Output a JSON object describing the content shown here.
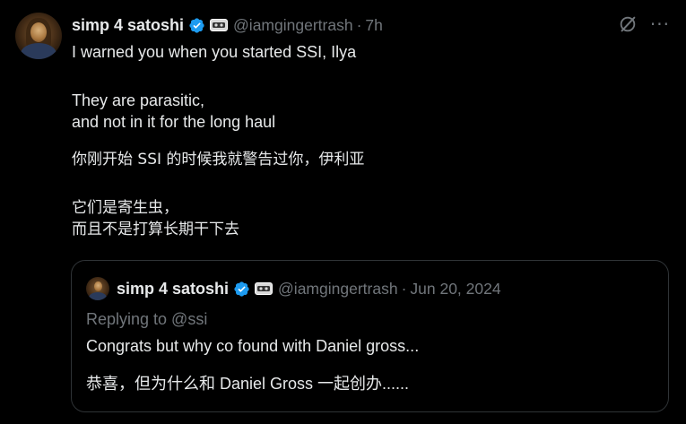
{
  "tweet": {
    "author": {
      "display_name": "simp 4 satoshi",
      "handle": "@iamgingertrash",
      "verified": true,
      "avatar_icon": "avatar-painting"
    },
    "separator": "·",
    "time": "7h",
    "lines": [
      "I warned you when you started SSI, Ilya",
      "They are parasitic,",
      "and not in it for the long haul",
      "你刚开始 SSI 的时候我就警告过你，伊利亚",
      "它们是寄生虫，",
      "而且不是打算长期干下去"
    ],
    "actions": {
      "grok_icon": "grok-icon",
      "more_icon": "more-icon",
      "more_label": "···"
    }
  },
  "quoted_tweet": {
    "author": {
      "display_name": "simp 4 satoshi",
      "handle": "@iamgingertrash",
      "verified": true
    },
    "separator": "·",
    "date": "Jun 20, 2024",
    "replying_to": "Replying to @ssi",
    "lines": [
      "Congrats but why co found with Daniel gross...",
      "恭喜，但为什么和 Daniel Gross 一起创办......"
    ]
  },
  "colors": {
    "background": "#000000",
    "text_primary": "#e7e9ea",
    "text_secondary": "#71767b",
    "verified_blue": "#1d9bf0",
    "border": "#2f3336"
  }
}
